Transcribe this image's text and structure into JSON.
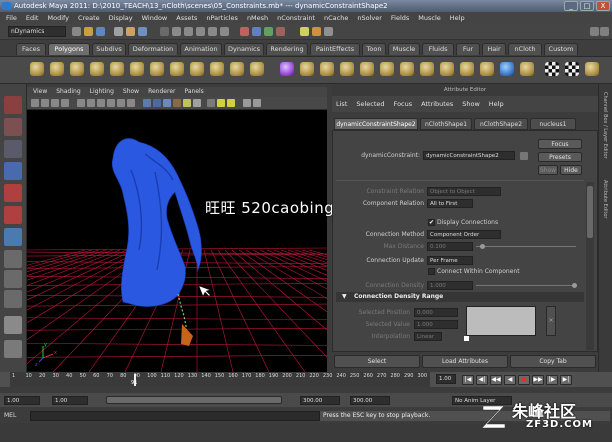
{
  "window": {
    "title": "Autodesk Maya 2011: D:\\2010_TEACH\\13_nCloth\\scenes\\05_Constraints.mb*   ---   dynamicConstraintShape2",
    "controls": [
      "_",
      "□",
      "X"
    ]
  },
  "menubar": [
    "File",
    "Edit",
    "Modify",
    "Create",
    "Display",
    "Window",
    "Assets",
    "nParticles",
    "nMesh",
    "nConstraint",
    "nCache",
    "nSolver",
    "Fields",
    "Muscle",
    "Help"
  ],
  "status_line": {
    "mode": "nDynamics"
  },
  "shelf": {
    "tabs": [
      "Faces",
      "Polygons",
      "Subdivs",
      "Deformation",
      "Animation",
      "Dynamics",
      "Rendering",
      "PaintEffects",
      "Toon",
      "Muscle",
      "Fluids",
      "Fur",
      "Hair",
      "nCloth",
      "Custom"
    ],
    "active_tab": "Polygons"
  },
  "viewport": {
    "menu": [
      "View",
      "Shading",
      "Lighting",
      "Show",
      "Renderer",
      "Panels"
    ],
    "axis": {
      "x": "x",
      "y": "y",
      "z": "z"
    }
  },
  "attribute_editor": {
    "title": "Attribute Editor",
    "menu": [
      "List",
      "Selected",
      "Focus",
      "Attributes",
      "Show",
      "Help"
    ],
    "tabs": [
      "dynamicConstraintShape2",
      "nClothShape1",
      "nClothShape2",
      "nucleus1"
    ],
    "active_tab": "dynamicConstraintShape2",
    "node_label": "dynamicConstraint:",
    "node_value": "dynamicConstraintShape2",
    "focus_button": "Focus",
    "presets_button": "Presets",
    "show_button": "Show",
    "hide_button": "Hide",
    "rows": {
      "constraint_relation": {
        "label": "Constraint Relation",
        "value": "Object to Object"
      },
      "component_relation": {
        "label": "Component Relation",
        "value": "All to First"
      },
      "display_connections": {
        "label": "Display Connections",
        "checked": true
      },
      "connection_method": {
        "label": "Connection Method",
        "value": "Component Order"
      },
      "max_distance": {
        "label": "Max Distance",
        "value": "0.100"
      },
      "connection_update": {
        "label": "Connection Update",
        "value": "Per Frame"
      },
      "connect_within_component": {
        "label": "Connect Within Component",
        "checked": false
      },
      "connection_density": {
        "label": "Connection Density",
        "value": "1.000"
      }
    },
    "section_header": "Connection Density Range",
    "density_range": {
      "selected_position": {
        "label": "Selected Position",
        "value": "0.000"
      },
      "selected_value": {
        "label": "Selected Value",
        "value": "1.000"
      },
      "interpolation": {
        "label": "Interpolation",
        "value": "Linear"
      }
    },
    "bottom_buttons": {
      "select": "Select",
      "load_attributes": "Load Attributes",
      "copy_tab": "Copy Tab"
    }
  },
  "side_strips": {
    "channel_box": "Channel Box / Layer Editor",
    "attribute_editor": "Attribute Editor"
  },
  "timeline": {
    "ticks": [
      "1",
      "10",
      "20",
      "30",
      "40",
      "50",
      "60",
      "70",
      "80",
      "90",
      "100",
      "110",
      "120",
      "130",
      "140",
      "150",
      "160",
      "170",
      "180",
      "190",
      "200",
      "210",
      "220",
      "230",
      "240",
      "250",
      "260",
      "270",
      "280",
      "290",
      "300"
    ],
    "current_frame": "91",
    "current_frame_value": 91,
    "frame_field": "1.00",
    "range": {
      "start": "1.00",
      "min": "1.00",
      "anim_start": "300.00",
      "anim_end": "300.00"
    },
    "anim_layer": "No Anim Layer"
  },
  "command_line": {
    "label": "MEL",
    "help": "Press the ESC key to stop playback."
  },
  "watermarks": {
    "overlay_text": "旺旺 520caobing88",
    "site_cn": "朱峰社区",
    "site_en": "ZF3D.COM"
  },
  "colors": {
    "mesh": "#1f4ed8",
    "grid": "#c0183a",
    "accent_tab": "#6e6e6e"
  }
}
